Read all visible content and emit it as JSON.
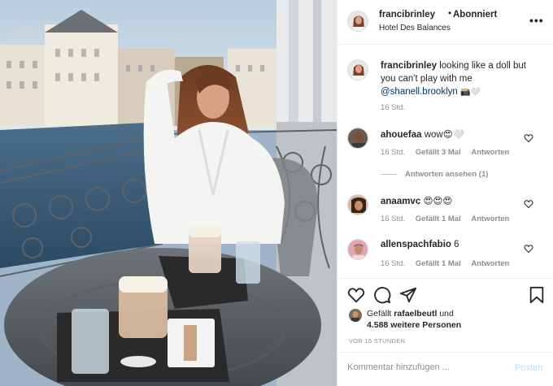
{
  "post": {
    "author": "francibrinley",
    "follow_status": "Abonniert",
    "location": "Hotel Des Balances",
    "more_icon": "ellipsis-icon"
  },
  "caption": {
    "username": "francibrinley",
    "text": "looking like a doll but you can't play with me",
    "mention": "@shanell.brooklyn",
    "emoji": "📸🤍",
    "time": "16 Std."
  },
  "comments": [
    {
      "username": "ahouefaa",
      "text": "wow😍🤍",
      "time": "16 Std.",
      "likes": "Gefällt 3 Mal",
      "reply": "Antworten"
    },
    {
      "username": "anaamvc",
      "text": "😍😍😍",
      "time": "16 Std.",
      "likes": "Gefällt 1 Mal",
      "reply": "Antworten"
    },
    {
      "username": "allenspachfabio",
      "text": "6",
      "time": "16 Std.",
      "likes": "Gefällt 1 Mal",
      "reply": "Antworten"
    }
  ],
  "view_replies": "Antworten ansehen (1)",
  "likes": {
    "prefix": "Gefällt",
    "user": "rafaelbeutl",
    "and": "und",
    "others": "4.588 weitere Personen"
  },
  "timestamp": "VOR 16 STUNDEN",
  "comment_box": {
    "placeholder": "Kommentar hinzufügen ...",
    "post_label": "Posten"
  },
  "colors": {
    "border": "#efefef",
    "secondary_text": "#8e8e8e",
    "mention": "#00376b",
    "post_button": "#b2dffc"
  }
}
